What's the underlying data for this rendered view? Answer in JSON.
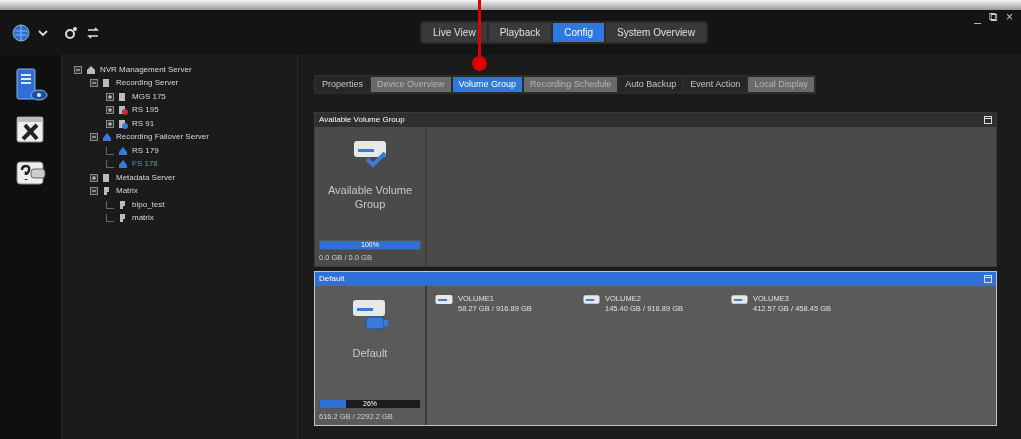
{
  "window": {
    "controls": [
      "_",
      "⧉",
      "×"
    ]
  },
  "main_tabs": [
    {
      "label": "Live View",
      "selected": false
    },
    {
      "label": "Playback",
      "selected": false
    },
    {
      "label": "Config",
      "selected": true
    },
    {
      "label": "System Overview",
      "selected": false
    }
  ],
  "tree": [
    {
      "label": "NVR Management Server",
      "kind": "management",
      "expanded": true,
      "selected": false,
      "children": [
        {
          "label": "Recording Server",
          "kind": "server",
          "expanded": true,
          "selected": false,
          "children": [
            {
              "label": "MGS 175",
              "kind": "server",
              "expanded": false,
              "selected": false
            },
            {
              "label": "RS 195",
              "kind": "warning",
              "expanded": false,
              "selected": false
            },
            {
              "label": "RS 91",
              "kind": "network",
              "expanded": false,
              "selected": false
            }
          ]
        },
        {
          "label": "Recording Failover Server",
          "kind": "failover",
          "expanded": true,
          "selected": false,
          "children": [
            {
              "label": "RS 179",
              "kind": "failover",
              "selected": false
            },
            {
              "label": "FS 178",
              "kind": "failover",
              "selected": true
            }
          ]
        },
        {
          "label": "Metadata Server",
          "kind": "server",
          "expanded": false,
          "selected": false
        },
        {
          "label": "Matrix",
          "kind": "matrix",
          "expanded": true,
          "selected": false,
          "children": [
            {
              "label": "bipo_test",
              "kind": "matrix",
              "selected": false
            },
            {
              "label": "matrix",
              "kind": "matrix",
              "selected": false
            }
          ]
        }
      ]
    }
  ],
  "config_tabs": [
    {
      "label": "Properties",
      "selected": false,
      "disabled": false
    },
    {
      "label": "Device Overview",
      "selected": false,
      "disabled": true
    },
    {
      "label": "Volume Group",
      "selected": true,
      "disabled": false
    },
    {
      "label": "Recording Schedule",
      "selected": false,
      "disabled": true
    },
    {
      "label": "Auto Backup",
      "selected": false,
      "disabled": false
    },
    {
      "label": "Event Action",
      "selected": false,
      "disabled": false
    },
    {
      "label": "Local Display",
      "selected": false,
      "disabled": true
    }
  ],
  "groups": [
    {
      "title": "Available Volume Group",
      "kind": "available",
      "selected": false,
      "name": "Available Volume Group",
      "level": 1,
      "percent": "100%",
      "usage": "0.0 GB / 0.0 GB"
    },
    {
      "title": "Default",
      "kind": "default",
      "selected": true,
      "name": "Default",
      "level": 0.26,
      "percent": "26%",
      "usage": "616.2 GB / 2292.2 GB",
      "volumes": [
        {
          "name": "VOLUME1",
          "usage": "58.27 GB / 916.89 GB"
        },
        {
          "name": "VOLUME2",
          "usage": "145.40 GB / 916.89 GB"
        },
        {
          "name": "VOLUME3",
          "usage": "412.57 GB / 458.45 GB"
        }
      ]
    }
  ]
}
